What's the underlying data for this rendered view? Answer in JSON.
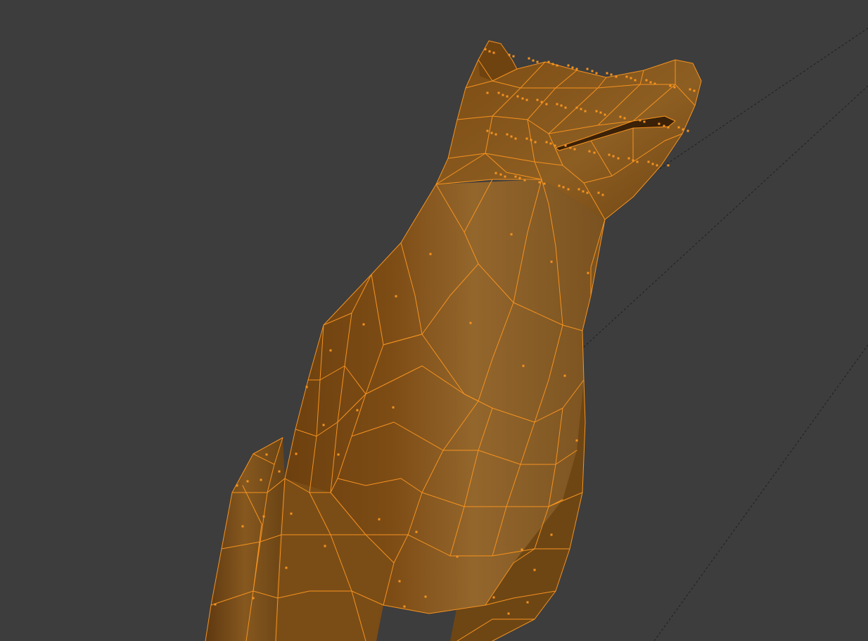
{
  "viewport": {
    "mode": "edit-mode",
    "background_color": "#3d3d3d",
    "selection_color": "#f5921f",
    "mesh_base_color": "#8a5a1c",
    "subject": "dog-mesh",
    "all_vertices_selected": true
  }
}
